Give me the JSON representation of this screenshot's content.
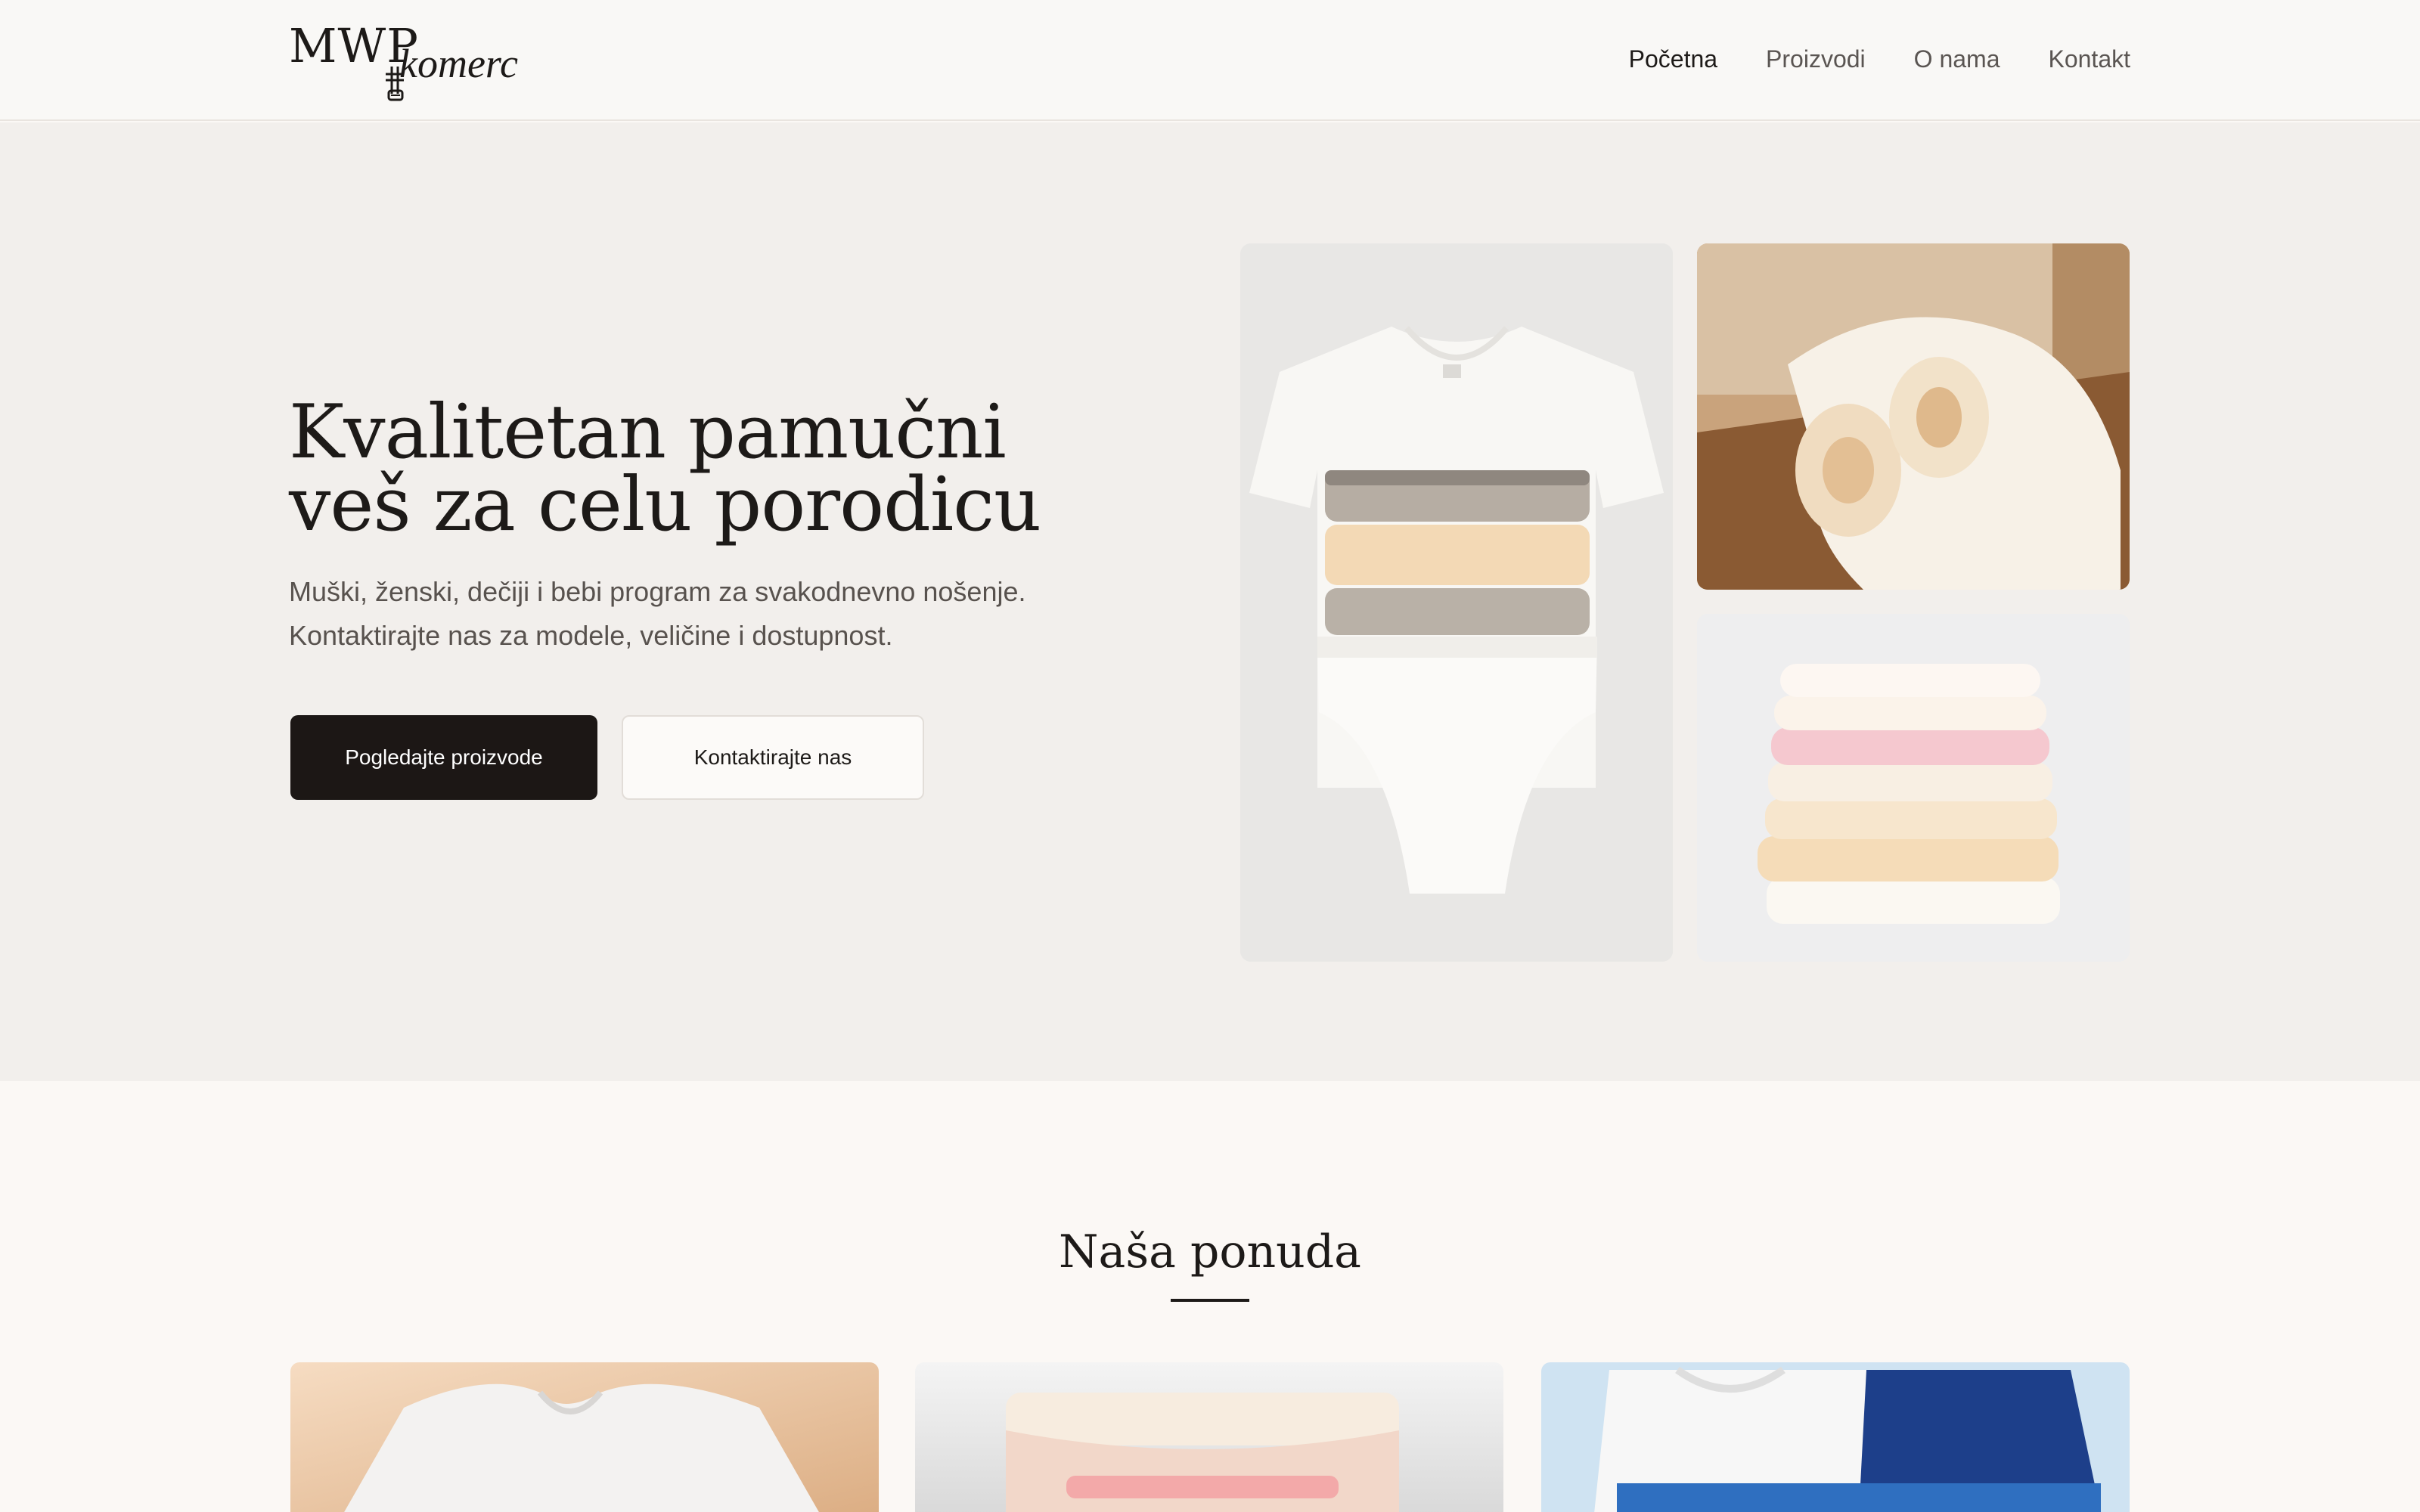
{
  "header": {
    "logo": {
      "primary": "MWP",
      "secondary": "komerc"
    },
    "nav": [
      {
        "label": "Početna",
        "active": true
      },
      {
        "label": "Proizvodi",
        "active": false
      },
      {
        "label": "O nama",
        "active": false
      },
      {
        "label": "Kontakt",
        "active": false
      }
    ]
  },
  "hero": {
    "title_lines": [
      "Kvalitetan pamučni",
      "veš za celu porodicu"
    ],
    "subtitle_lines": [
      "Muški, ženski, dečiji i bebi program za svakodnevno nošenje.",
      "Kontaktirajte nas za modele, veličine i dostupnost."
    ],
    "primary_button": "Pogledajte proizvode",
    "secondary_button": "Kontaktirajte nas"
  },
  "offer": {
    "title": "Naša ponuda"
  },
  "colors": {
    "brand_dark": "#1c1715",
    "hero_bg": "#f2efec",
    "page_bg": "#fbf8f5"
  }
}
